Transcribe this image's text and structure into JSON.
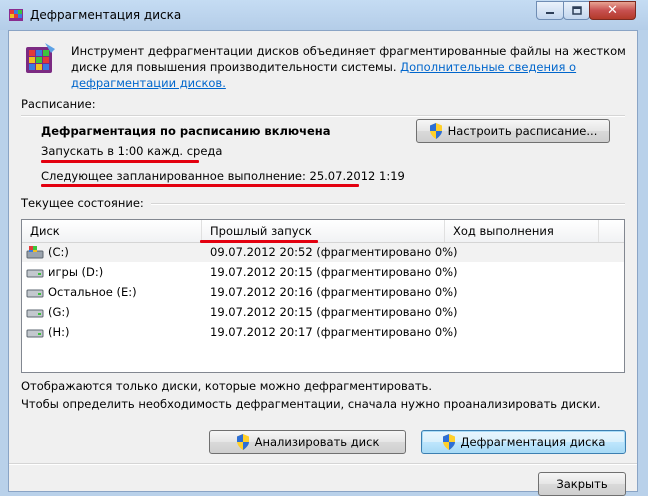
{
  "window": {
    "title": "Дефрагментация диска",
    "controls": {
      "minimize": "minimize-icon",
      "maximize": "maximize-icon",
      "close": "close-icon"
    }
  },
  "intro": {
    "text": "Инструмент дефрагментации дисков объединяет фрагментированные файлы на жестком диске для повышения производительности системы.",
    "link": "Дополнительные сведения о дефрагментации дисков."
  },
  "schedule": {
    "group_label": "Расписание:",
    "status": "Дефрагментация по расписанию включена",
    "run_at": "Запускать в 1:00 кажд. среда",
    "next_run": "Следующее запланированное выполнение: 25.07.2012 1:19",
    "configure_button": "Настроить расписание..."
  },
  "current": {
    "group_label": "Текущее состояние:",
    "columns": [
      "Диск",
      "Прошлый запуск",
      "Ход выполнения"
    ],
    "rows": [
      {
        "disk": "(C:)",
        "last_run": "09.07.2012 20:52 (фрагментировано 0%)",
        "progress": "",
        "icon": "system-drive-icon"
      },
      {
        "disk": "игры (D:)",
        "last_run": "19.07.2012 20:15 (фрагментировано 0%)",
        "progress": "",
        "icon": "drive-icon"
      },
      {
        "disk": "Остальное (E:)",
        "last_run": "19.07.2012 20:16 (фрагментировано 0%)",
        "progress": "",
        "icon": "drive-icon"
      },
      {
        "disk": "(G:)",
        "last_run": "19.07.2012 20:15 (фрагментировано 0%)",
        "progress": "",
        "icon": "drive-icon"
      },
      {
        "disk": "(H:)",
        "last_run": "19.07.2012 20:17 (фрагментировано 0%)",
        "progress": "",
        "icon": "drive-icon"
      }
    ]
  },
  "footer": {
    "note1": "Отображаются только диски, которые можно дефрагментировать.",
    "note2": "Чтобы определить необходимость  дефрагментации, сначала нужно проанализировать диски.",
    "analyze_button": "Анализировать диск",
    "defrag_button": "Дефрагментация диска",
    "close_button": "Закрыть"
  },
  "colors": {
    "annotation": "#e3000f",
    "link": "#0066cc",
    "title_bar": "#b9d1ea"
  }
}
